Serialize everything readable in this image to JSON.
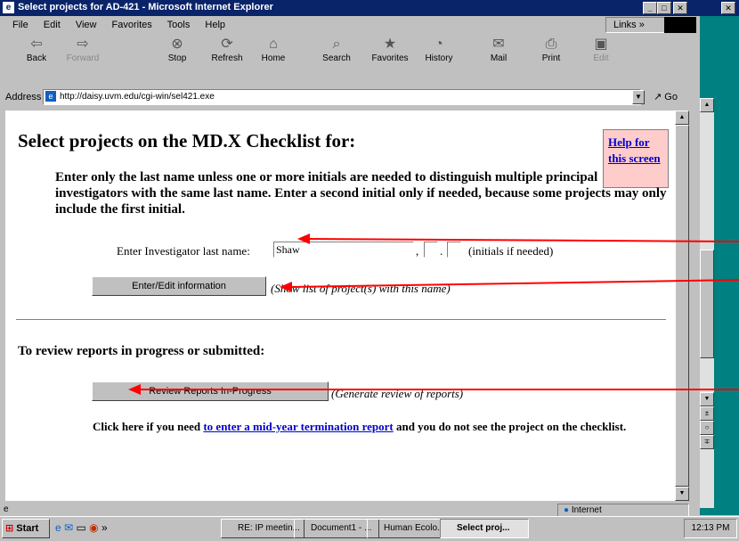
{
  "window": {
    "title": "Select projects for AD-421 - Microsoft Internet Explorer"
  },
  "menu": [
    "File",
    "Edit",
    "View",
    "Favorites",
    "Tools",
    "Help"
  ],
  "links_label": "Links",
  "toolbar": {
    "back": "Back",
    "forward": "Forward",
    "stop": "Stop",
    "refresh": "Refresh",
    "home": "Home",
    "search": "Search",
    "favorites": "Favorites",
    "history": "History",
    "mail": "Mail",
    "print": "Print",
    "edit": "Edit"
  },
  "address": {
    "label": "Address",
    "url": "http://daisy.uvm.edu/cgi-win/sel421.exe",
    "go": "Go"
  },
  "page": {
    "heading": "Select projects on the MD.X Checklist for:",
    "help_link": "Help for this screen",
    "instructions": "Enter only the last name unless one or more initials are needed to distinguish multiple principal investigators with the same last name. Enter a second initial only if needed, because some projects may only include the first initial.",
    "investigator_label": "Enter Investigator last name:",
    "last_name_value": "Shaw",
    "initials_hint": "(initials if needed)",
    "enter_button": "Enter/Edit information",
    "enter_hint": "(Show list of project(s) with this name)",
    "review_heading": "To review reports in progress or submitted:",
    "review_button": "Review Reports In-Progress",
    "review_hint": "(Generate review of reports)",
    "mid_year_prefix": "Click here if you need ",
    "mid_year_link": "to enter a mid-year termination report",
    "mid_year_suffix": " and you do not see the project on the checklist."
  },
  "status": {
    "zone": "Internet"
  },
  "taskbar": {
    "start": "Start",
    "items": [
      "RE: IP meetin...",
      "Document1 - ...",
      "Human Ecolo...",
      "Select proj..."
    ],
    "clock": "12:13 PM"
  },
  "colors": {
    "arrow": "#ff0000",
    "link": "#0000cc",
    "help_bg": "#ffcccc",
    "titlebar": "#0a246a"
  }
}
